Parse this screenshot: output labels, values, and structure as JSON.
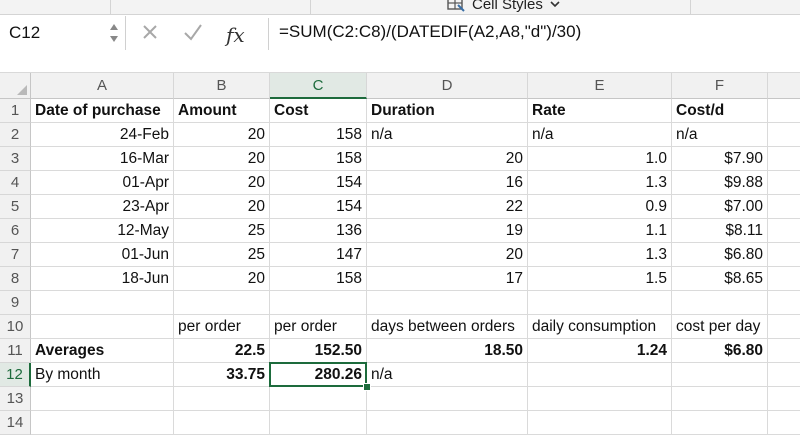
{
  "ribbon": {
    "cell_styles_label": "Cell Styles",
    "cell_styles_icon": "cell-styles-icon",
    "dropdown_icon": "chevron-down-icon"
  },
  "formula_bar": {
    "name_box": "C12",
    "cancel_icon": "x-icon",
    "enter_icon": "check-icon",
    "fx_label": "fx",
    "formula": "=SUM(C2:C8)/(DATEDIF(A2,A8,\"d\")/30)"
  },
  "columns": [
    "A",
    "B",
    "C",
    "D",
    "E",
    "F"
  ],
  "selected_column": "C",
  "selected_row": "12",
  "rows": [
    {
      "num": "1",
      "cells": [
        "Date of purchase",
        "Amount",
        "Cost",
        "Duration",
        "Rate",
        "Cost/d"
      ]
    },
    {
      "num": "2",
      "cells": [
        "24-Feb",
        "20",
        "158",
        "n/a",
        "n/a",
        "n/a"
      ]
    },
    {
      "num": "3",
      "cells": [
        "16-Mar",
        "20",
        "158",
        "20",
        "1.0",
        "$7.90"
      ]
    },
    {
      "num": "4",
      "cells": [
        "01-Apr",
        "20",
        "154",
        "16",
        "1.3",
        "$9.88"
      ]
    },
    {
      "num": "5",
      "cells": [
        "23-Apr",
        "20",
        "154",
        "22",
        "0.9",
        "$7.00"
      ]
    },
    {
      "num": "6",
      "cells": [
        "12-May",
        "25",
        "136",
        "19",
        "1.1",
        "$8.11"
      ]
    },
    {
      "num": "7",
      "cells": [
        "01-Jun",
        "25",
        "147",
        "20",
        "1.3",
        "$6.80"
      ]
    },
    {
      "num": "8",
      "cells": [
        "18-Jun",
        "20",
        "158",
        "17",
        "1.5",
        "$8.65"
      ]
    },
    {
      "num": "9",
      "cells": [
        "",
        "",
        "",
        "",
        "",
        ""
      ]
    },
    {
      "num": "10",
      "cells": [
        "",
        "per order",
        "per order",
        "days between orders",
        "daily consumption",
        "cost per day"
      ]
    },
    {
      "num": "11",
      "cells": [
        "Averages",
        "22.5",
        "152.50",
        "18.50",
        "1.24",
        "$6.80"
      ]
    },
    {
      "num": "12",
      "cells": [
        "By month",
        "33.75",
        "280.26",
        "n/a",
        "",
        ""
      ]
    },
    {
      "num": "13",
      "cells": [
        "",
        "",
        "",
        "",
        "",
        ""
      ]
    },
    {
      "num": "14",
      "cells": [
        "",
        "",
        "",
        "",
        "",
        ""
      ]
    }
  ]
}
